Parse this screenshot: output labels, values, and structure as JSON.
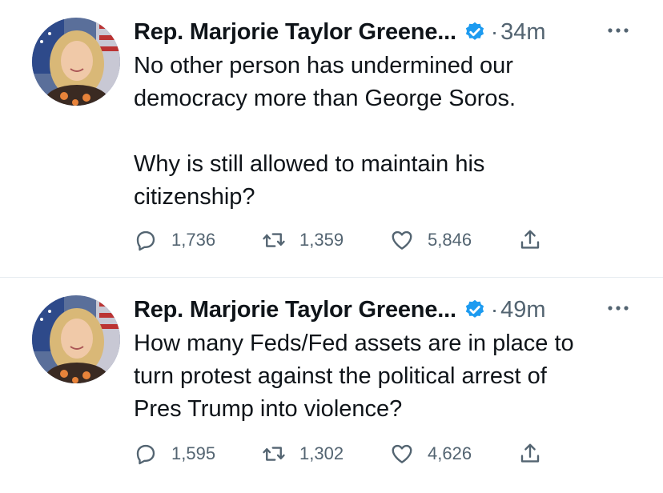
{
  "colors": {
    "text": "#0f1419",
    "secondary": "#536471",
    "verified": "#1d9bf0",
    "divider": "#e6ecf0",
    "background": "#ffffff"
  },
  "tweets": [
    {
      "author": "Rep. Marjorie Taylor Greene...",
      "verified_icon": "verified-badge-icon",
      "separator": "·",
      "time": "34m",
      "more_icon": "more-icon",
      "text": "No other person has undermined our\ndemocracy more than George Soros.\n\nWhy is still allowed to maintain his\ncitizenship?",
      "reply_count": "1,736",
      "retweet_count": "1,359",
      "like_count": "5,846"
    },
    {
      "author": "Rep. Marjorie Taylor Greene...",
      "verified_icon": "verified-badge-icon",
      "separator": "·",
      "time": "49m",
      "more_icon": "more-icon",
      "text": "How many Feds/Fed assets are in place to\nturn protest against the political arrest of\nPres Trump into violence?",
      "reply_count": "1,595",
      "retweet_count": "1,302",
      "like_count": "4,626"
    }
  ]
}
